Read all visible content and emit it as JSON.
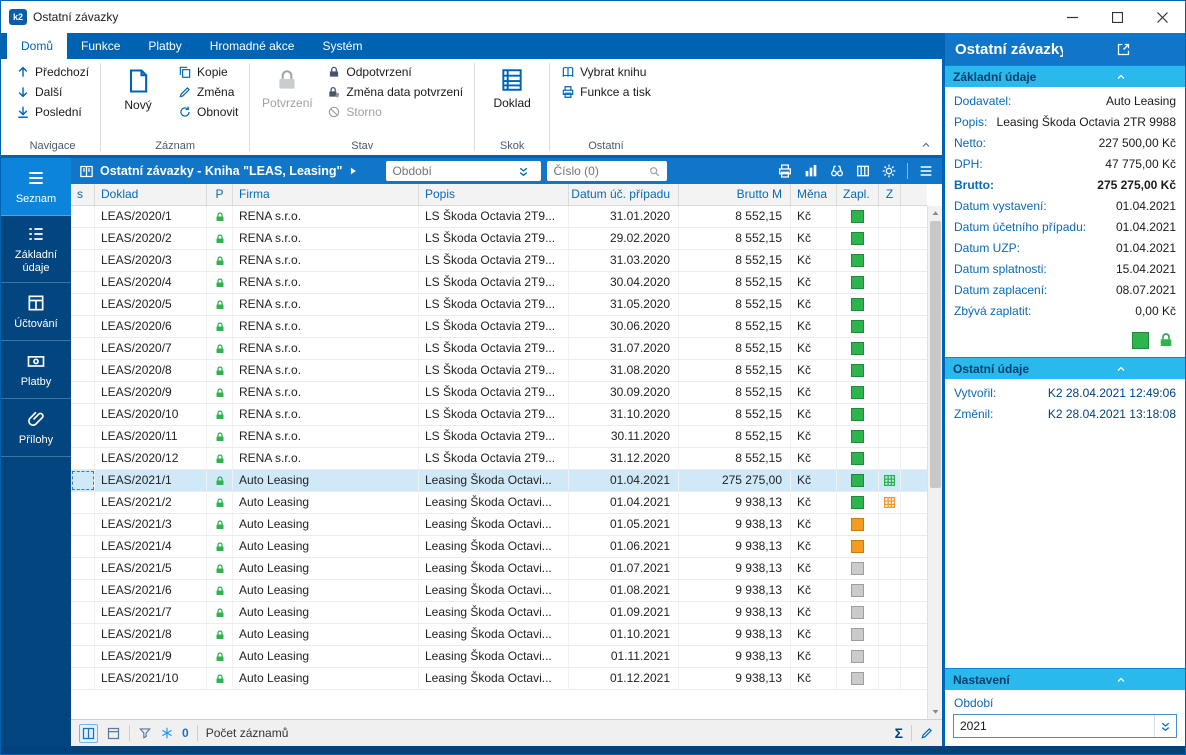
{
  "window": {
    "title": "Ostatní závazky"
  },
  "colors": {
    "accent": "#0063b1",
    "grid_header": "#1176c8",
    "section_header": "#29b9ec",
    "paid": "#2eb44d",
    "partial": "#f59b22",
    "unpaid": "#cbcbcb",
    "sidebar_active": "#0d84dc"
  },
  "icons": [
    "app-icon",
    "minimize-icon",
    "maximize-icon",
    "close-icon",
    "arrow-up-icon",
    "arrow-down-icon",
    "arrow-down-bar-icon",
    "new-document-icon",
    "copy-icon",
    "pencil-icon",
    "refresh-icon",
    "lock-icon",
    "lock-pencil-icon",
    "storno-icon",
    "document-icon",
    "book-icon",
    "printer-icon",
    "play-icon",
    "dropdown-chevrons-icon",
    "magnifier-icon",
    "chart-icon",
    "binoculars-icon",
    "columns-icon",
    "gear-icon",
    "menu-icon",
    "chevron-up-icon",
    "expand-icon",
    "funnel-icon",
    "snowflake-icon",
    "panel-icon",
    "sum-symbol",
    "paperclip-icon",
    "grid-green-icon",
    "grid-orange-icon"
  ],
  "ribbon": {
    "tabs": [
      {
        "label": "Domů",
        "active": true
      },
      {
        "label": "Funkce",
        "active": false
      },
      {
        "label": "Platby",
        "active": false
      },
      {
        "label": "Hromadné akce",
        "active": false
      },
      {
        "label": "Systém",
        "active": false
      }
    ],
    "groups": {
      "navigace": {
        "title": "Navigace",
        "prev": "Předchozí",
        "next": "Další",
        "last": "Poslední"
      },
      "zaznam": {
        "title": "Záznam",
        "novy": "Nový",
        "kopie": "Kopie",
        "zmena": "Změna",
        "obnovit": "Obnovit"
      },
      "stav": {
        "title": "Stav",
        "potvrzeni": "Potvrzení",
        "odpotvrzeni": "Odpotvrzení",
        "zmena_data": "Změna data potvrzení",
        "storno": "Storno"
      },
      "skok": {
        "title": "Skok",
        "doklad": "Doklad"
      },
      "ostatni": {
        "title": "Ostatní",
        "vybrat_knihu": "Vybrat knihu",
        "funkce_a_tisk": "Funkce a tisk"
      }
    }
  },
  "sidebar": {
    "items": [
      {
        "label": "Seznam",
        "active": true
      },
      {
        "label": "Základní údaje",
        "active": false
      },
      {
        "label": "Účtování",
        "active": false
      },
      {
        "label": "Platby",
        "active": false
      },
      {
        "label": "Přílohy",
        "active": false
      }
    ]
  },
  "grid": {
    "title": "Ostatní závazky - Kniha \"LEAS, Leasing\"",
    "search_period_placeholder": "Období",
    "search_number_placeholder": "Číslo (0)",
    "columns": [
      "s",
      "Doklad",
      "P",
      "Firma",
      "Popis",
      "Datum úč. případu",
      "Brutto M",
      "Měna",
      "Zapl.",
      "Z"
    ],
    "rows": [
      {
        "doklad": "LEAS/2020/1",
        "firma": "RENA s.r.o.",
        "popis": "LS Škoda Octavia 2T9...",
        "datum": "31.01.2020",
        "brutto": "8 552,15",
        "mena": "Kč",
        "zapl": "green",
        "z": "",
        "selected": false
      },
      {
        "doklad": "LEAS/2020/2",
        "firma": "RENA s.r.o.",
        "popis": "LS Škoda Octavia 2T9...",
        "datum": "29.02.2020",
        "brutto": "8 552,15",
        "mena": "Kč",
        "zapl": "green",
        "z": "",
        "selected": false
      },
      {
        "doklad": "LEAS/2020/3",
        "firma": "RENA s.r.o.",
        "popis": "LS Škoda Octavia 2T9...",
        "datum": "31.03.2020",
        "brutto": "8 552,15",
        "mena": "Kč",
        "zapl": "green",
        "z": "",
        "selected": false
      },
      {
        "doklad": "LEAS/2020/4",
        "firma": "RENA s.r.o.",
        "popis": "LS Škoda Octavia 2T9...",
        "datum": "30.04.2020",
        "brutto": "8 552,15",
        "mena": "Kč",
        "zapl": "green",
        "z": "",
        "selected": false
      },
      {
        "doklad": "LEAS/2020/5",
        "firma": "RENA s.r.o.",
        "popis": "LS Škoda Octavia 2T9...",
        "datum": "31.05.2020",
        "brutto": "8 552,15",
        "mena": "Kč",
        "zapl": "green",
        "z": "",
        "selected": false
      },
      {
        "doklad": "LEAS/2020/6",
        "firma": "RENA s.r.o.",
        "popis": "LS Škoda Octavia 2T9...",
        "datum": "30.06.2020",
        "brutto": "8 552,15",
        "mena": "Kč",
        "zapl": "green",
        "z": "",
        "selected": false
      },
      {
        "doklad": "LEAS/2020/7",
        "firma": "RENA s.r.o.",
        "popis": "LS Škoda Octavia 2T9...",
        "datum": "31.07.2020",
        "brutto": "8 552,15",
        "mena": "Kč",
        "zapl": "green",
        "z": "",
        "selected": false
      },
      {
        "doklad": "LEAS/2020/8",
        "firma": "RENA s.r.o.",
        "popis": "LS Škoda Octavia 2T9...",
        "datum": "31.08.2020",
        "brutto": "8 552,15",
        "mena": "Kč",
        "zapl": "green",
        "z": "",
        "selected": false
      },
      {
        "doklad": "LEAS/2020/9",
        "firma": "RENA s.r.o.",
        "popis": "LS Škoda Octavia 2T9...",
        "datum": "30.09.2020",
        "brutto": "8 552,15",
        "mena": "Kč",
        "zapl": "green",
        "z": "",
        "selected": false
      },
      {
        "doklad": "LEAS/2020/10",
        "firma": "RENA s.r.o.",
        "popis": "LS Škoda Octavia 2T9...",
        "datum": "31.10.2020",
        "brutto": "8 552,15",
        "mena": "Kč",
        "zapl": "green",
        "z": "",
        "selected": false
      },
      {
        "doklad": "LEAS/2020/11",
        "firma": "RENA s.r.o.",
        "popis": "LS Škoda Octavia 2T9...",
        "datum": "30.11.2020",
        "brutto": "8 552,15",
        "mena": "Kč",
        "zapl": "green",
        "z": "",
        "selected": false
      },
      {
        "doklad": "LEAS/2020/12",
        "firma": "RENA s.r.o.",
        "popis": "LS Škoda Octavia 2T9...",
        "datum": "31.12.2020",
        "brutto": "8 552,15",
        "mena": "Kč",
        "zapl": "green",
        "z": "",
        "selected": false
      },
      {
        "doklad": "LEAS/2021/1",
        "firma": "Auto Leasing",
        "popis": "Leasing Škoda Octavi...",
        "datum": "01.04.2021",
        "brutto": "275 275,00",
        "mena": "Kč",
        "zapl": "green",
        "z": "green",
        "selected": true
      },
      {
        "doklad": "LEAS/2021/2",
        "firma": "Auto Leasing",
        "popis": "Leasing Škoda Octavi...",
        "datum": "01.04.2021",
        "brutto": "9 938,13",
        "mena": "Kč",
        "zapl": "green",
        "z": "orange",
        "selected": false
      },
      {
        "doklad": "LEAS/2021/3",
        "firma": "Auto Leasing",
        "popis": "Leasing Škoda Octavi...",
        "datum": "01.05.2021",
        "brutto": "9 938,13",
        "mena": "Kč",
        "zapl": "orange",
        "z": "",
        "selected": false
      },
      {
        "doklad": "LEAS/2021/4",
        "firma": "Auto Leasing",
        "popis": "Leasing Škoda Octavi...",
        "datum": "01.06.2021",
        "brutto": "9 938,13",
        "mena": "Kč",
        "zapl": "orange",
        "z": "",
        "selected": false
      },
      {
        "doklad": "LEAS/2021/5",
        "firma": "Auto Leasing",
        "popis": "Leasing Škoda Octavi...",
        "datum": "01.07.2021",
        "brutto": "9 938,13",
        "mena": "Kč",
        "zapl": "gray",
        "z": "",
        "selected": false
      },
      {
        "doklad": "LEAS/2021/6",
        "firma": "Auto Leasing",
        "popis": "Leasing Škoda Octavi...",
        "datum": "01.08.2021",
        "brutto": "9 938,13",
        "mena": "Kč",
        "zapl": "gray",
        "z": "",
        "selected": false
      },
      {
        "doklad": "LEAS/2021/7",
        "firma": "Auto Leasing",
        "popis": "Leasing Škoda Octavi...",
        "datum": "01.09.2021",
        "brutto": "9 938,13",
        "mena": "Kč",
        "zapl": "gray",
        "z": "",
        "selected": false
      },
      {
        "doklad": "LEAS/2021/8",
        "firma": "Auto Leasing",
        "popis": "Leasing Škoda Octavi...",
        "datum": "01.10.2021",
        "brutto": "9 938,13",
        "mena": "Kč",
        "zapl": "gray",
        "z": "",
        "selected": false
      },
      {
        "doklad": "LEAS/2021/9",
        "firma": "Auto Leasing",
        "popis": "Leasing Škoda Octavi...",
        "datum": "01.11.2021",
        "brutto": "9 938,13",
        "mena": "Kč",
        "zapl": "gray",
        "z": "",
        "selected": false
      },
      {
        "doklad": "LEAS/2021/10",
        "firma": "Auto Leasing",
        "popis": "Leasing Škoda Octavi...",
        "datum": "01.12.2021",
        "brutto": "9 938,13",
        "mena": "Kč",
        "zapl": "gray",
        "z": "",
        "selected": false
      }
    ]
  },
  "statusbar": {
    "filter_count": "0",
    "records_label": "Počet záznamů",
    "sum_symbol": "Σ"
  },
  "detail": {
    "title": "Ostatní závazky LEA...",
    "sections": {
      "zakladni": {
        "title": "Základní údaje",
        "fields": [
          {
            "label": "Dodavatel:",
            "value": "Auto Leasing",
            "bold": false
          },
          {
            "label": "Popis:",
            "value": "Leasing Škoda Octavia 2TR 9988",
            "bold": false
          },
          {
            "label": "Netto:",
            "value": "227 500,00 Kč",
            "bold": false
          },
          {
            "label": "DPH:",
            "value": "47 775,00 Kč",
            "bold": false
          },
          {
            "label": "Brutto:",
            "value": "275 275,00 Kč",
            "bold": true
          },
          {
            "label": "Datum vystavení:",
            "value": "01.04.2021",
            "bold": false
          },
          {
            "label": "Datum účetního případu:",
            "value": "01.04.2021",
            "bold": false
          },
          {
            "label": "Datum UZP:",
            "value": "01.04.2021",
            "bold": false
          },
          {
            "label": "Datum splatnosti:",
            "value": "15.04.2021",
            "bold": false
          },
          {
            "label": "Datum zaplacení:",
            "value": "08.07.2021",
            "bold": false
          },
          {
            "label": "Zbývá zaplatit:",
            "value": "0,00 Kč",
            "bold": false
          }
        ]
      },
      "ostatni": {
        "title": "Ostatní údaje",
        "fields": [
          {
            "label": "Vytvořil:",
            "value": "K2 28.04.2021 12:49:06"
          },
          {
            "label": "Změnil:",
            "value": "K2 28.04.2021 13:18:08"
          }
        ]
      },
      "nastaveni": {
        "title": "Nastavení",
        "period_label": "Období",
        "period_value": "2021"
      }
    }
  }
}
